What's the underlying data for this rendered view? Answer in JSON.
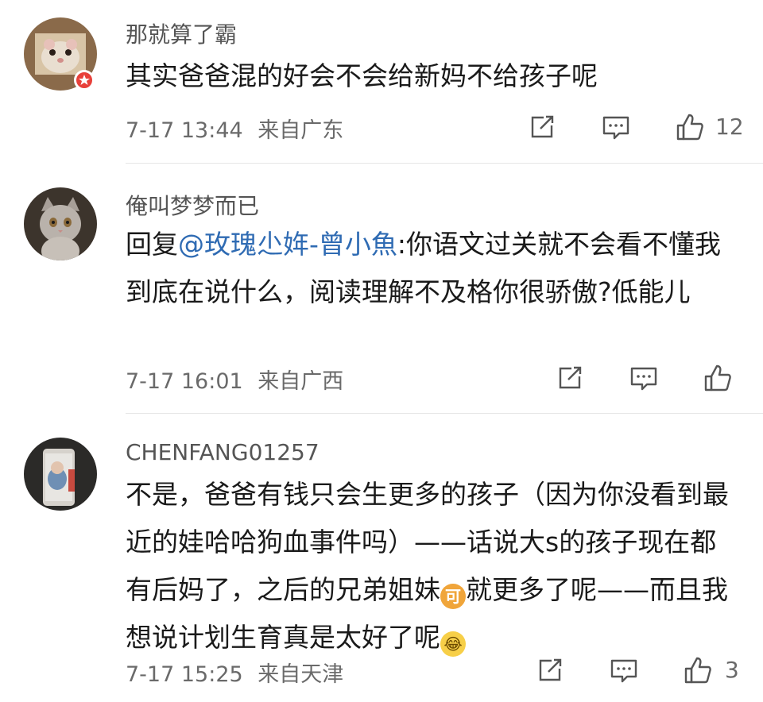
{
  "comments": [
    {
      "username": "那就算了霸",
      "text": "其实爸爸混的好会不会给新妈不给孩子呢",
      "time": "7-17 13:44",
      "location": "来自广东",
      "likes": "12"
    },
    {
      "username": "俺叫梦梦而已",
      "reply_prefix": "回复",
      "mention": "@玫瑰尐姩-曾小魚",
      "text": ":你语文过关就不会看不懂我到底在说什么，阅读理解不及格你很骄傲?低能儿",
      "time": "7-17 16:01",
      "location": "来自广西",
      "likes": ""
    },
    {
      "username": "CHENFANG01257",
      "text_part1": "不是，爸爸有钱只会生更多的孩子（因为你没看到最近的娃哈哈狗血事件吗）——话说大s的孩子现在都有后妈了，之后的兄弟姐妹",
      "emoji1_label": "可",
      "text_part2": "就更多了呢——而且我想说计划生育真是太好了呢",
      "emoji2_label": "😂",
      "time": "7-17 15:25",
      "location": "来自天津",
      "likes": "3"
    }
  ],
  "icons": {
    "share": "share-icon",
    "comment": "comment-icon",
    "like": "thumbs-up-icon"
  },
  "colors": {
    "mention": "#2f6bb3",
    "badge": "#e8403a",
    "meta_text": "#6a6a6a"
  }
}
